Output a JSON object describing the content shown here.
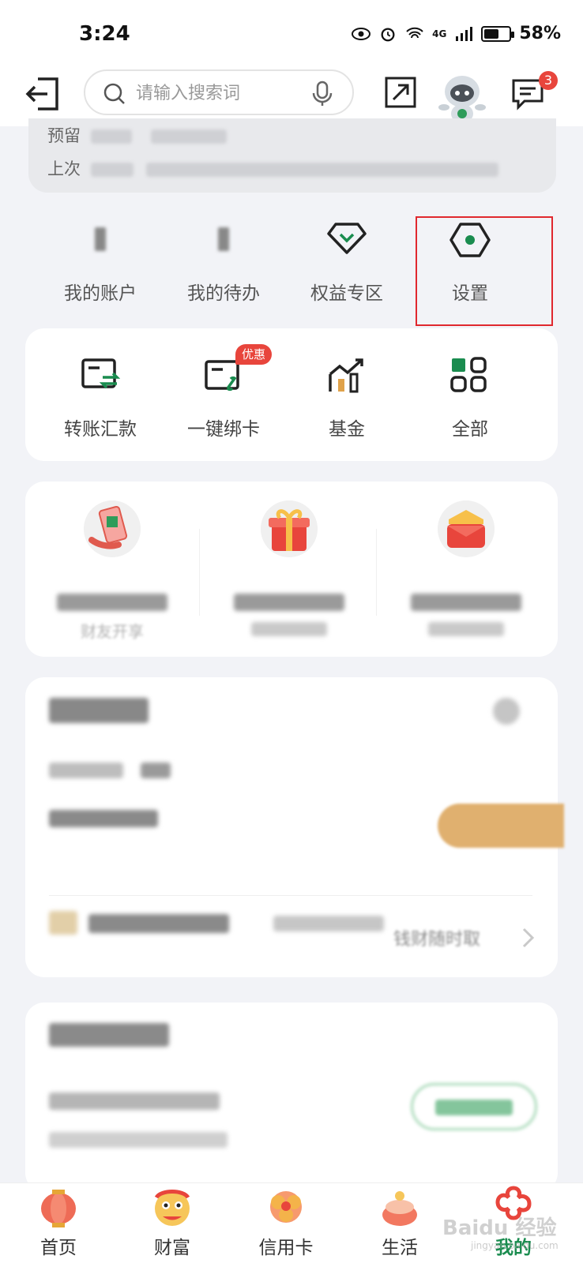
{
  "status_bar": {
    "time": "3:24",
    "network": "4G",
    "battery": "58%",
    "battery_level": 0.58
  },
  "top_bar": {
    "search_placeholder": "请输入搜索词",
    "message_count": "3"
  },
  "account": {
    "line1_label": "预留",
    "line2_label": "上次"
  },
  "stats": [
    {
      "label": "我的账户"
    },
    {
      "label": "我的待办"
    },
    {
      "label": "权益专区"
    },
    {
      "label": "设置"
    }
  ],
  "quick_actions": [
    {
      "label": "转账汇款",
      "icon": "transfer-icon"
    },
    {
      "label": "一键绑卡",
      "icon": "bind-card-icon",
      "badge": "优惠"
    },
    {
      "label": "基金",
      "icon": "fund-icon"
    },
    {
      "label": "全部",
      "icon": "grid-icon"
    }
  ],
  "promos": [
    {
      "icon": "phone-qr-icon",
      "sub": "财友开享"
    },
    {
      "icon": "gift-box-icon"
    },
    {
      "icon": "red-envelope-icon"
    }
  ],
  "finance": {
    "link_text": "钱财随时取"
  },
  "tabs": [
    {
      "label": "首页",
      "icon": "lantern-icon"
    },
    {
      "label": "财富",
      "icon": "lion-dance-icon"
    },
    {
      "label": "信用卡",
      "icon": "flower-icon"
    },
    {
      "label": "生活",
      "icon": "cake-icon"
    },
    {
      "label": "我的",
      "icon": "knot-icon",
      "active": true
    }
  ],
  "watermark": {
    "text": "Baidu 经验",
    "sub": "jingyan.baidu.com"
  },
  "colors": {
    "accent": "#1a8c4f",
    "badge": "#e8453c",
    "highlight": "#e0282e"
  }
}
